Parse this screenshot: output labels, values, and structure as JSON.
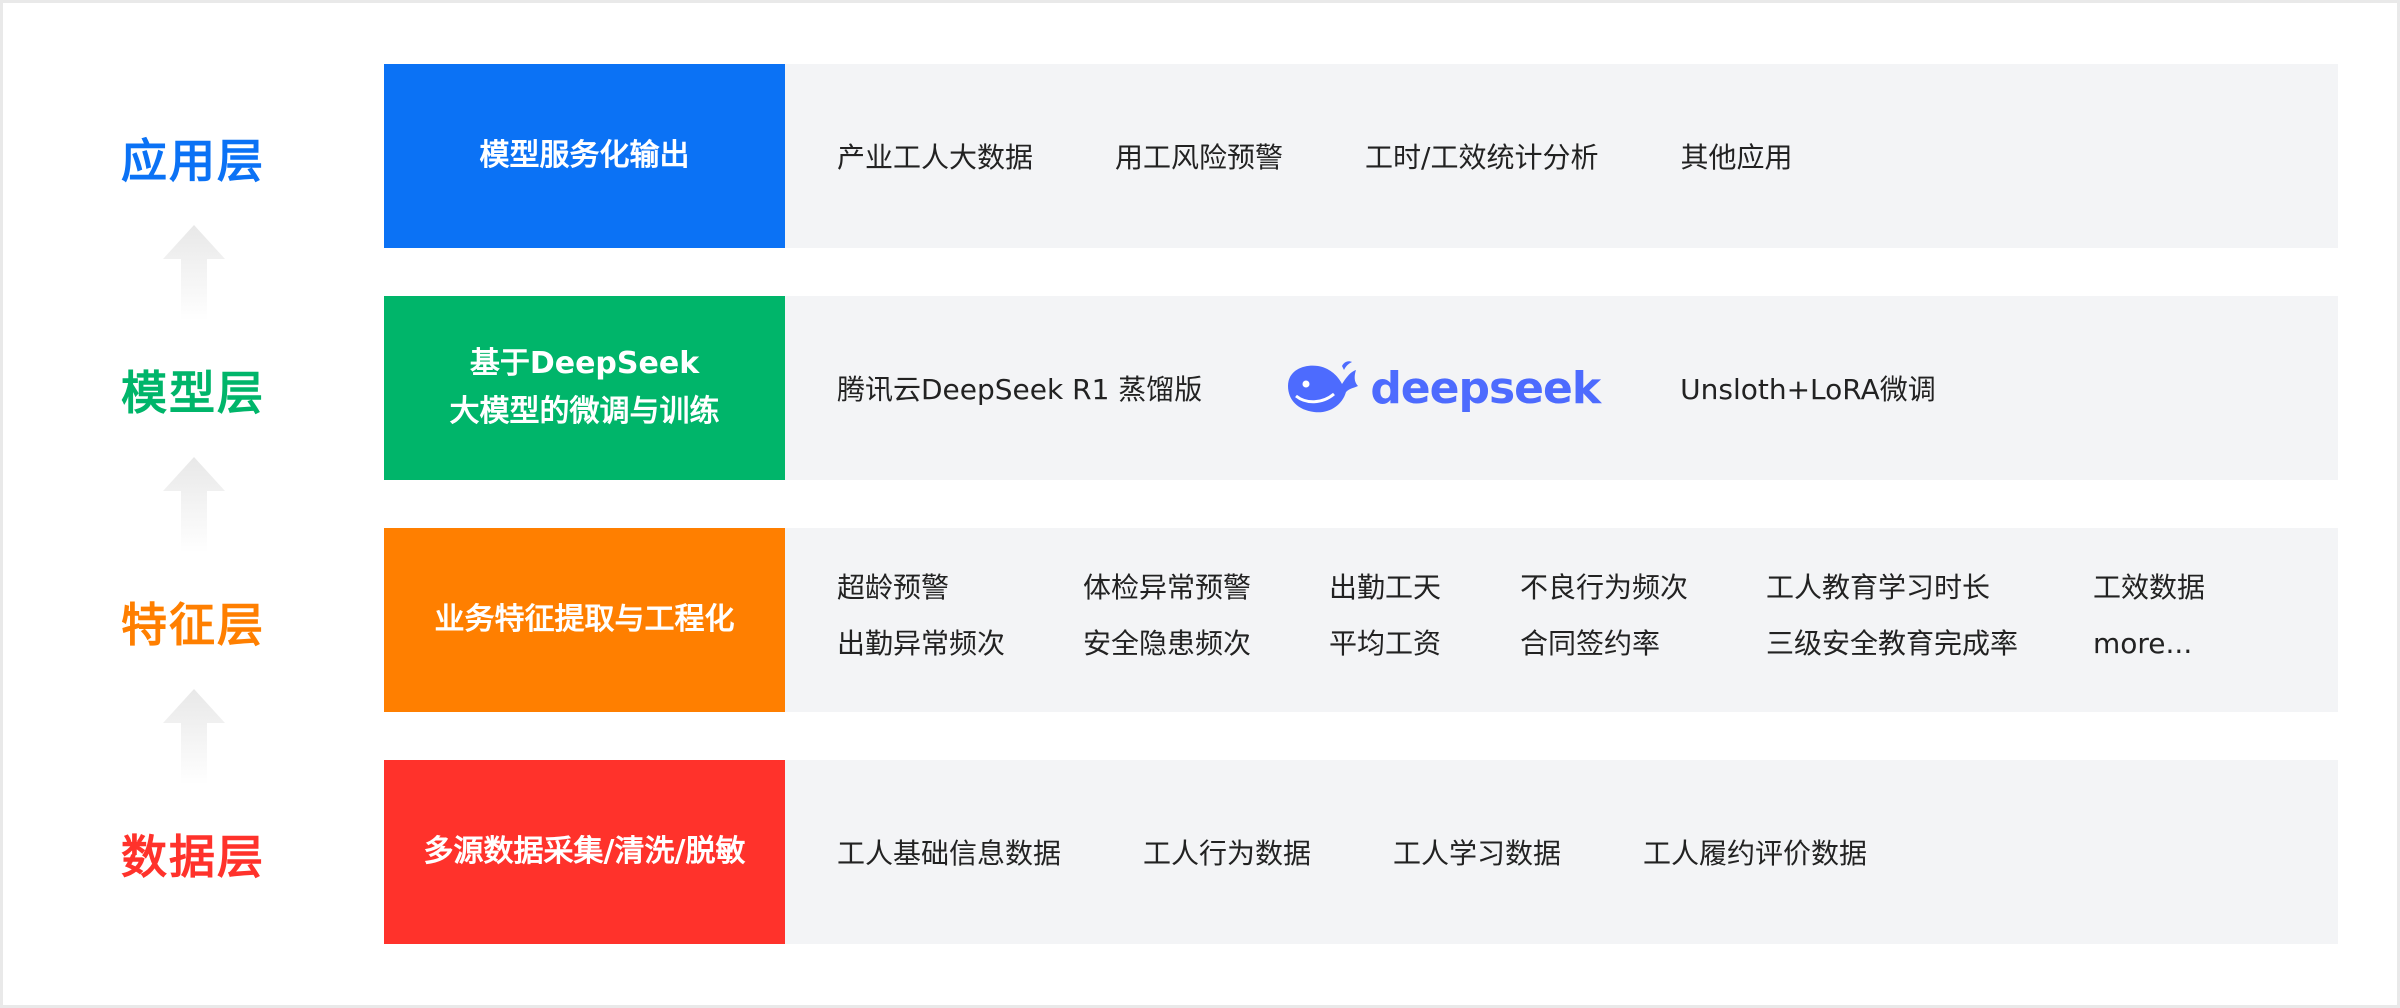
{
  "colors": {
    "app": "#0b72f5",
    "model": "#00b56a",
    "feature": "#ff7f00",
    "data": "#ff322b",
    "logo": "#4d6bfe"
  },
  "layers": {
    "app": {
      "label": "应用层",
      "title": "模型服务化输出",
      "items": [
        "产业工人大数据",
        "用工风险预警",
        "工时/工效统计分析",
        "其他应用"
      ]
    },
    "model": {
      "label": "模型层",
      "title_line1": "基于DeepSeek",
      "title_line2": "大模型的微调与训练",
      "item1": "腾讯云DeepSeek R1 蒸馏版",
      "logo_text": "deepseek",
      "item2": "Unsloth+LoRA微调"
    },
    "feature": {
      "label": "特征层",
      "title": "业务特征提取与工程化",
      "row1": [
        "超龄预警",
        "体检异常预警",
        "出勤工天",
        "不良行为频次",
        "工人教育学习时长",
        "工效数据"
      ],
      "row2": [
        "出勤异常频次",
        "安全隐患频次",
        "平均工资",
        "合同签约率",
        "三级安全教育完成率",
        "more..."
      ]
    },
    "data": {
      "label": "数据层",
      "title": "多源数据采集/清洗/脱敏",
      "items": [
        "工人基础信息数据",
        "工人行为数据",
        "工人学习数据",
        "工人履约评价数据"
      ]
    }
  }
}
